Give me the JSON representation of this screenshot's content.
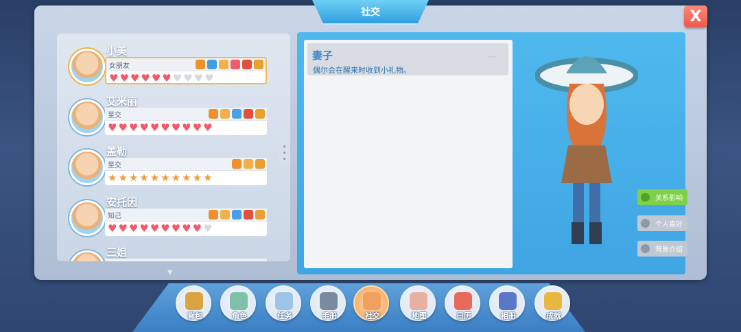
{
  "window": {
    "title": "社交",
    "close_glyph": "X"
  },
  "characters": [
    {
      "name": "小美",
      "relation": "女朋友",
      "meter": "heart",
      "filled": 5,
      "half": 1,
      "empty": 4,
      "icons": [
        "camera-icon",
        "gift-box-icon",
        "glove-icon",
        "heart-icon",
        "speech-bubble-icon",
        "present-icon"
      ],
      "selected": true
    },
    {
      "name": "艾米丽",
      "relation": "至交",
      "meter": "heart",
      "filled": 10,
      "half": 0,
      "empty": 0,
      "icons": [
        "camera-icon",
        "glove-icon",
        "shirt-icon",
        "speech-bubble-icon",
        "present-icon"
      ],
      "selected": false
    },
    {
      "name": "盖勒",
      "relation": "至交",
      "meter": "star",
      "filled": 10,
      "half": 0,
      "empty": 0,
      "icons": [
        "camera-icon",
        "glove-icon",
        "present-icon"
      ],
      "selected": false
    },
    {
      "name": "安托因",
      "relation": "知己",
      "meter": "heart",
      "filled": 9,
      "half": 0,
      "empty": 1,
      "icons": [
        "camera-icon",
        "glove-icon",
        "shirt-icon",
        "speech-bubble-icon",
        "present-icon"
      ],
      "selected": false
    },
    {
      "name": "三姐",
      "relation": "",
      "meter": "heart",
      "filled": 0,
      "half": 0,
      "empty": 0,
      "icons": [],
      "selected": false
    }
  ],
  "detail": {
    "title": "妻子",
    "description": "偶尔会在醒来时收到小礼物。",
    "more_glyph": "···"
  },
  "side_tabs": [
    {
      "label": "关系影响",
      "active": true
    },
    {
      "label": "个人喜好",
      "active": false
    },
    {
      "label": "背景介绍",
      "active": false
    }
  ],
  "nav": [
    {
      "label": "背包",
      "icon": "backpack-icon",
      "color": "#d9a441"
    },
    {
      "label": "角色",
      "icon": "character-icon",
      "color": "#7fc0a8"
    },
    {
      "label": "任务",
      "icon": "clipboard-icon",
      "color": "#9cc4e8"
    },
    {
      "label": "手册",
      "icon": "hammer-icon",
      "color": "#7a8aa0"
    },
    {
      "label": "社交",
      "icon": "handshake-icon",
      "color": "#f0a060",
      "active": true
    },
    {
      "label": "地图",
      "icon": "map-icon",
      "color": "#e8b0a0"
    },
    {
      "label": "日历",
      "icon": "calendar-icon",
      "color": "#e86a5a"
    },
    {
      "label": "相册",
      "icon": "album-icon",
      "color": "#5a78c8"
    },
    {
      "label": "成就",
      "icon": "trophy-icon",
      "color": "#e8b840"
    }
  ],
  "colors": {
    "accent": "#3fa5e3",
    "heart": "#f05a6a",
    "star": "#f39a3b",
    "active_tab": "#7fd14a",
    "close": "#f0584a"
  }
}
